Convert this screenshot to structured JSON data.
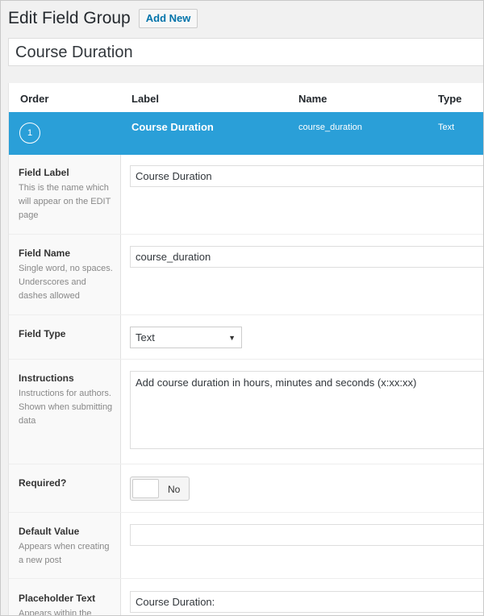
{
  "header": {
    "title": "Edit Field Group",
    "add_new": "Add New"
  },
  "group_title": "Course Duration",
  "fields_table": {
    "columns": [
      "Order",
      "Label",
      "Name",
      "Type"
    ],
    "active_field": {
      "order": "1",
      "label": "Course Duration",
      "name": "course_duration",
      "type": "Text"
    }
  },
  "settings": {
    "field_label": {
      "label": "Field Label",
      "desc": "This is the name which will appear on the EDIT page",
      "value": "Course Duration"
    },
    "field_name": {
      "label": "Field Name",
      "desc": "Single word, no spaces. Underscores and dashes allowed",
      "value": "course_duration"
    },
    "field_type": {
      "label": "Field Type",
      "value": "Text"
    },
    "instructions": {
      "label": "Instructions",
      "desc": "Instructions for authors. Shown when submitting data",
      "value": "Add course duration in hours, minutes and seconds (x:xx:xx)"
    },
    "required": {
      "label": "Required?",
      "toggle_text": "No"
    },
    "default_value": {
      "label": "Default Value",
      "desc": "Appears when creating a new post",
      "value": ""
    },
    "placeholder_text": {
      "label": "Placeholder Text",
      "desc": "Appears within the",
      "value": "Course Duration:"
    }
  },
  "colors": {
    "accent": "#2a9fd8",
    "link": "#0073aa"
  }
}
